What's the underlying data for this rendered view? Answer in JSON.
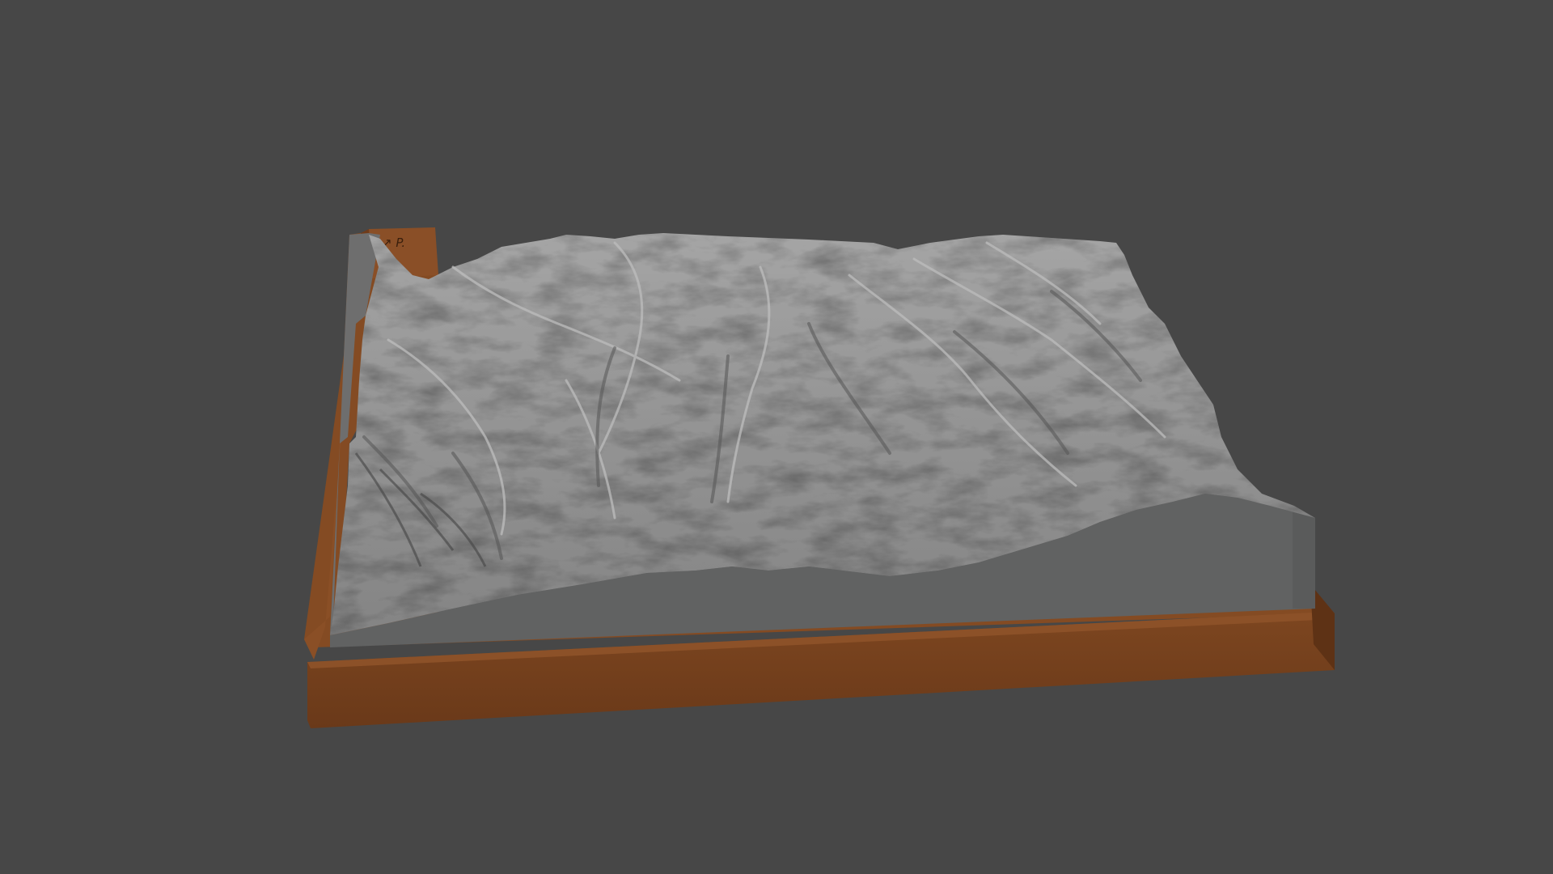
{
  "scene": {
    "background_color": "#474747",
    "model": "terrain-relief-on-base",
    "terrain_color": "#8f8f8f",
    "terrain_side_color": "#616262",
    "base_color": "#814a22",
    "base_front_color": "#6b3a1a",
    "plate_engraving": "↗ P.",
    "icons": [
      "terrain-relief-icon",
      "base-plate-icon"
    ]
  }
}
